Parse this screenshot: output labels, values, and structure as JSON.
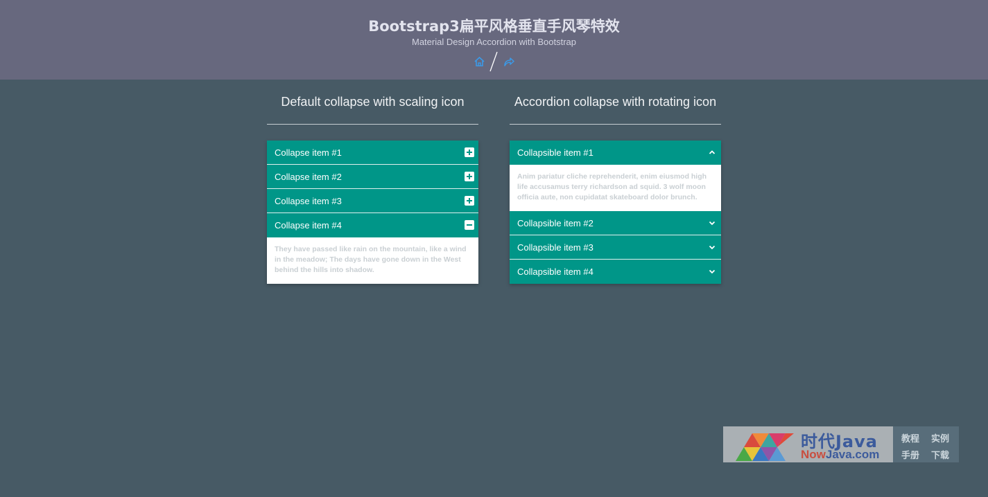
{
  "header": {
    "title": "Bootstrap3扁平风格垂直手风琴特效",
    "subtitle": "Material Design Accordion with Bootstrap",
    "home_icon": "home-icon",
    "share_icon": "share-icon"
  },
  "left": {
    "title": "Default collapse with scaling icon",
    "items": [
      {
        "label": "Collapse item #1",
        "state": "collapsed"
      },
      {
        "label": "Collapse item #2",
        "state": "collapsed"
      },
      {
        "label": "Collapse item #3",
        "state": "collapsed"
      },
      {
        "label": "Collapse item #4",
        "state": "expanded"
      }
    ],
    "open_body": "They have passed like rain on the mountain, like a wind in the meadow; The days have gone down in the West behind the hills into shadow."
  },
  "right": {
    "title": "Accordion collapse with rotating icon",
    "items": [
      {
        "label": "Collapsible item #1",
        "state": "expanded"
      },
      {
        "label": "Collapsible item #2",
        "state": "collapsed"
      },
      {
        "label": "Collapsible item #3",
        "state": "collapsed"
      },
      {
        "label": "Collapsible item #4",
        "state": "collapsed"
      }
    ],
    "open_body": "Anim pariatur cliche reprehenderit, enim eiusmod high life accusamus terry richardson ad squid. 3 wolf moon officia aute, non cupidatat skateboard dolor brunch."
  },
  "watermark": {
    "brand_cn": "时代Java",
    "brand_en_now": "Now",
    "brand_en_rest": "Java.com",
    "links": [
      "教程",
      "实例",
      "手册",
      "下载"
    ]
  },
  "colors": {
    "header_bg": "#67687e",
    "page_bg": "#475a65",
    "accent": "#009688"
  }
}
